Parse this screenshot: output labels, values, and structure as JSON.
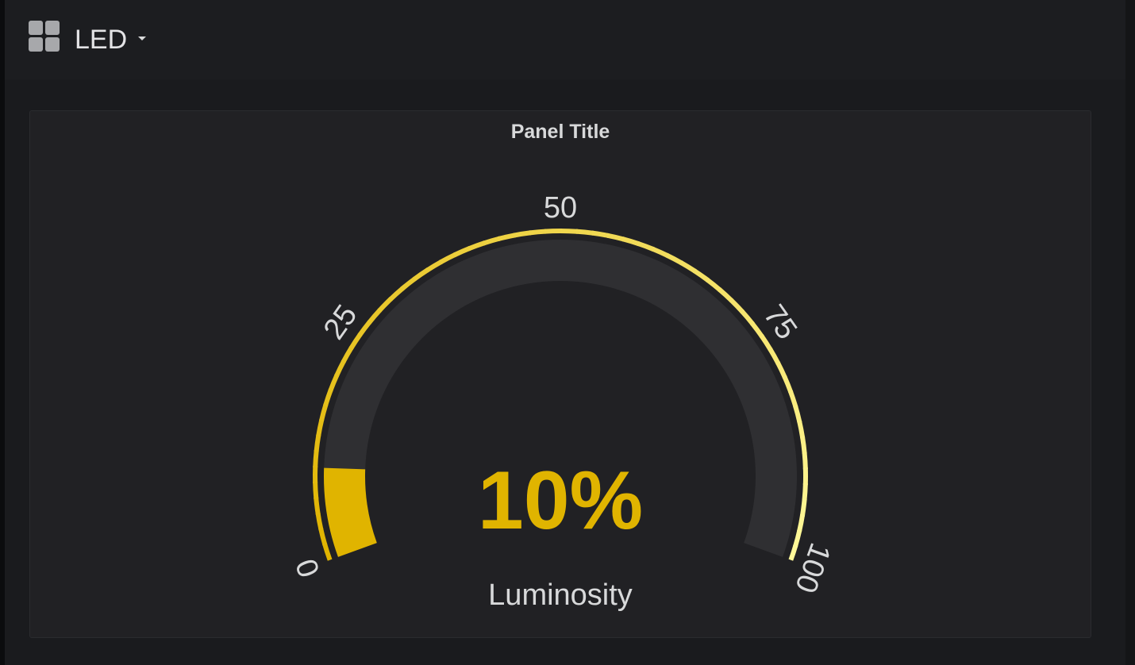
{
  "dashboard": {
    "title": "LED",
    "icon": "dashboard-grid-icon",
    "caret_icon": "caret-down-icon"
  },
  "panel": {
    "title": "Panel Title"
  },
  "colors": {
    "page_bg": "#161719",
    "panel_bg": "#212124",
    "track": "#2f2f32",
    "value": "#e0b400",
    "threshold_start": "#e0b400",
    "threshold_end": "#fff899",
    "text": "#d8d9da"
  },
  "chart_data": {
    "type": "gauge",
    "value": 10,
    "value_text": "10%",
    "label": "Luminosity",
    "min": 0,
    "max": 100,
    "ticks": [
      {
        "value": 0,
        "label": "0"
      },
      {
        "value": 25,
        "label": "25"
      },
      {
        "value": 50,
        "label": "50"
      },
      {
        "value": 75,
        "label": "75"
      },
      {
        "value": 100,
        "label": "100"
      }
    ]
  }
}
